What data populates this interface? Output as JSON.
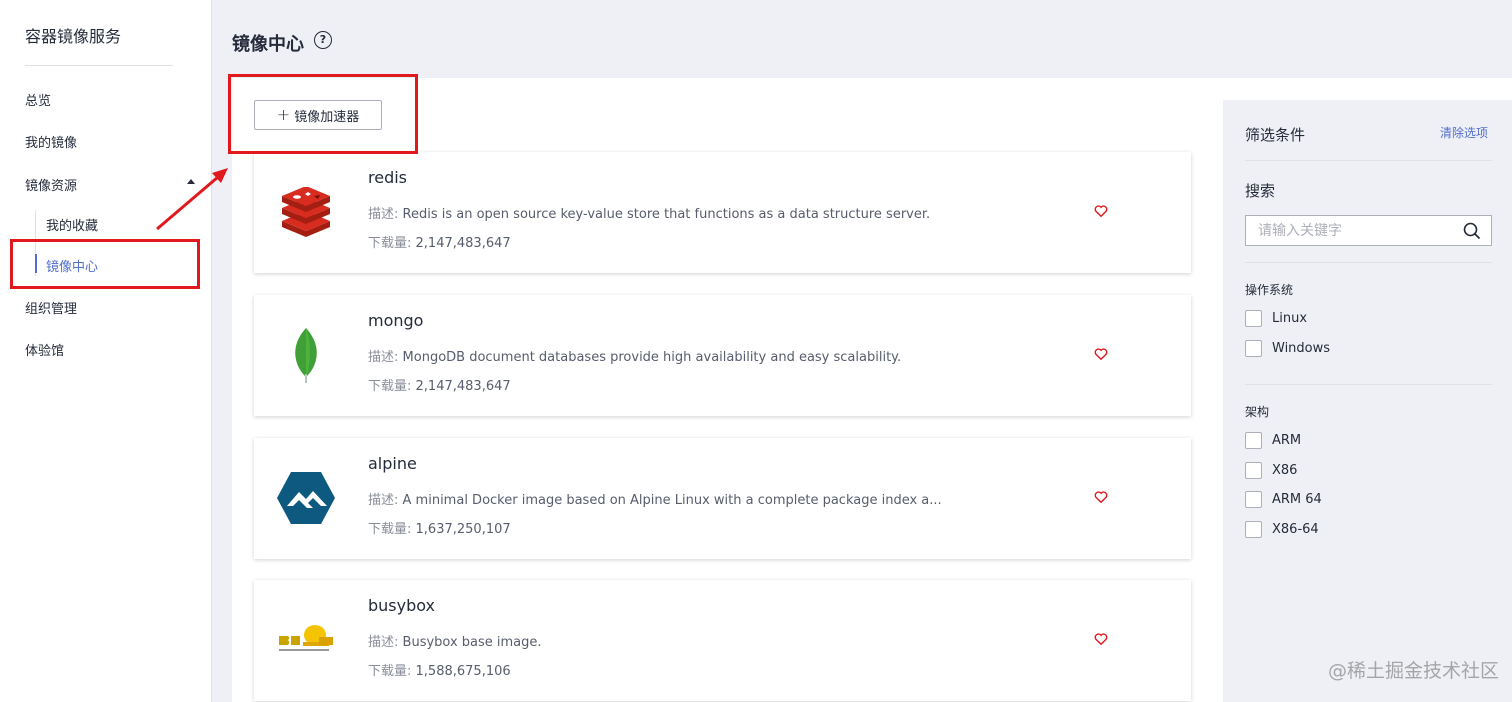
{
  "sidebar": {
    "title": "容器镜像服务",
    "items": [
      {
        "label": "总览"
      },
      {
        "label": "我的镜像"
      },
      {
        "label": "镜像资源"
      },
      {
        "label": "组织管理"
      },
      {
        "label": "体验馆"
      }
    ],
    "sub_items": [
      {
        "label": "我的收藏",
        "active": false
      },
      {
        "label": "镜像中心",
        "active": true
      }
    ]
  },
  "header": {
    "title": "镜像中心",
    "help_symbol": "?"
  },
  "toolbar": {
    "accelerator_label": "镜像加速器",
    "plus_symbol": "+"
  },
  "images": [
    {
      "name": "redis",
      "desc_label": "描述:",
      "desc": "Redis is an open source key-value store that functions as a data structure server.",
      "downloads_label": "下载量:",
      "downloads": "2,147,483,647",
      "logo": "redis-logo"
    },
    {
      "name": "mongo",
      "desc_label": "描述:",
      "desc": "MongoDB document databases provide high availability and easy scalability.",
      "downloads_label": "下载量:",
      "downloads": "2,147,483,647",
      "logo": "mongo-leaf-logo"
    },
    {
      "name": "alpine",
      "desc_label": "描述:",
      "desc": "A minimal Docker image based on Alpine Linux with a complete package index a...",
      "downloads_label": "下载量:",
      "downloads": "1,637,250,107",
      "logo": "alpine-logo"
    },
    {
      "name": "busybox",
      "desc_label": "描述:",
      "desc": "Busybox base image.",
      "downloads_label": "下载量:",
      "downloads": "1,588,675,106",
      "logo": "buildroot-logo"
    }
  ],
  "filter": {
    "title": "筛选条件",
    "clear_label": "清除选项",
    "search_title": "搜索",
    "search_placeholder": "请输入关键字",
    "os_title": "操作系统",
    "os_options": [
      "Linux",
      "Windows"
    ],
    "arch_title": "架构",
    "arch_options": [
      "ARM",
      "X86",
      "ARM 64",
      "X86-64"
    ]
  },
  "watermark": "@稀土掘金技术社区",
  "colors": {
    "accent": "#526ecc",
    "annotation_red": "#e0191d",
    "favorite_red": "#e0191d"
  }
}
